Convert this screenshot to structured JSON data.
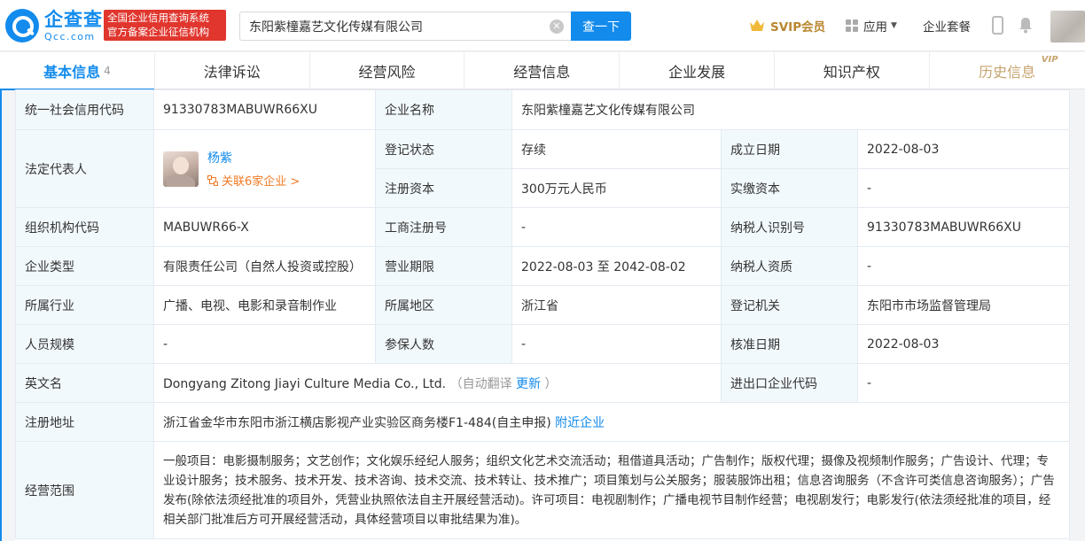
{
  "header": {
    "logo_cn": "企查查",
    "logo_en": "Qcc.com",
    "gov_badge_line1": "全国企业信用查询系统",
    "gov_badge_line2": "官方备案企业征信机构",
    "search_value": "东阳紫橦嘉艺文化传媒有限公司",
    "search_button": "查一下",
    "svip_label": "SVIP会员",
    "apps_label": "应用",
    "suite_label": "企业套餐"
  },
  "tabs": [
    {
      "label": "基本信息",
      "count": "4"
    },
    {
      "label": "法律诉讼"
    },
    {
      "label": "经营风险"
    },
    {
      "label": "经营信息"
    },
    {
      "label": "企业发展"
    },
    {
      "label": "知识产权"
    },
    {
      "label": "历史信息",
      "vip": "VIP"
    }
  ],
  "info": {
    "credit_code_label": "统一社会信用代码",
    "credit_code": "91330783MABUWR66XU",
    "company_name_label": "企业名称",
    "company_name": "东阳紫橦嘉艺文化传媒有限公司",
    "legal_rep_label": "法定代表人",
    "legal_rep_name": "杨紫",
    "legal_rep_related": "关联6家企业 >",
    "reg_status_label": "登记状态",
    "reg_status": "存续",
    "found_date_label": "成立日期",
    "found_date": "2022-08-03",
    "reg_capital_label": "注册资本",
    "reg_capital": "300万元人民币",
    "paid_capital_label": "实缴资本",
    "paid_capital": "-",
    "org_code_label": "组织机构代码",
    "org_code": "MABUWR66-X",
    "biz_reg_no_label": "工商注册号",
    "biz_reg_no": "-",
    "taxpayer_id_label": "纳税人识别号",
    "taxpayer_id": "91330783MABUWR66XU",
    "company_type_label": "企业类型",
    "company_type": "有限责任公司（自然人投资或控股）",
    "biz_term_label": "营业期限",
    "biz_term": "2022-08-03 至 2042-08-02",
    "taxpayer_qual_label": "纳税人资质",
    "taxpayer_qual": "-",
    "industry_label": "所属行业",
    "industry": "广播、电视、电影和录音制作业",
    "region_label": "所属地区",
    "region": "浙江省",
    "reg_authority_label": "登记机关",
    "reg_authority": "东阳市市场监督管理局",
    "staff_size_label": "人员规模",
    "staff_size": "-",
    "insured_label": "参保人数",
    "insured": "-",
    "approval_date_label": "核准日期",
    "approval_date": "2022-08-03",
    "english_name_label": "英文名",
    "english_name": "Dongyang Zitong Jiayi Culture Media Co., Ltd.",
    "auto_translate": "（自动翻译",
    "update_link": "更新",
    "paren_close": "）",
    "import_export_label": "进出口企业代码",
    "import_export": "-",
    "address_label": "注册地址",
    "address": "浙江省金华市东阳市浙江横店影视产业实验区商务楼F1-484(自主申报)",
    "nearby_link": "附近企业",
    "scope_label": "经营范围",
    "scope": "一般项目：电影摄制服务；文艺创作；文化娱乐经纪人服务；组织文化艺术交流活动；租借道具活动；广告制作；版权代理；摄像及视频制作服务；广告设计、代理；专业设计服务；技术服务、技术开发、技术咨询、技术交流、技术转让、技术推广；项目策划与公关服务；服装服饰出租；信息咨询服务（不含许可类信息咨询服务）；广告发布(除依法须经批准的项目外，凭营业执照依法自主开展经营活动)。许可项目：电视剧制作；广播电视节目制作经营；电视剧发行；电影发行(依法须经批准的项目，经相关部门批准后方可开展经营活动，具体经营项目以审批结果为准)。"
  }
}
